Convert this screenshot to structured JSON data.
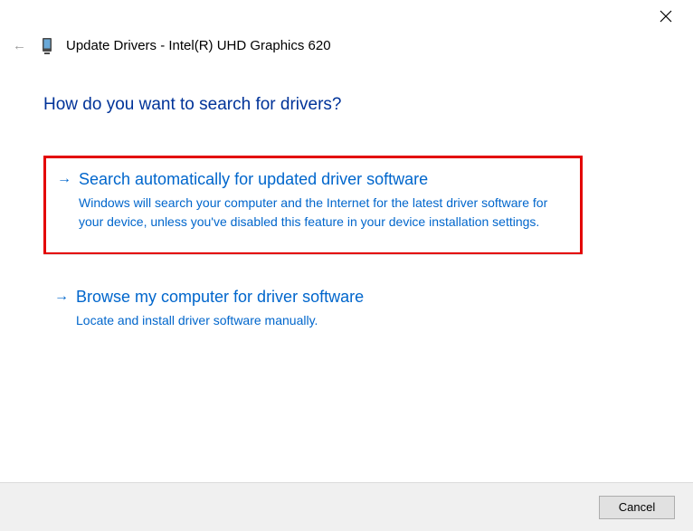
{
  "header": {
    "title": "Update Drivers - Intel(R) UHD Graphics 620"
  },
  "question": "How do you want to search for drivers?",
  "options": {
    "auto": {
      "title": "Search automatically for updated driver software",
      "description": "Windows will search your computer and the Internet for the latest driver software for your device, unless you've disabled this feature in your device installation settings."
    },
    "browse": {
      "title": "Browse my computer for driver software",
      "description": "Locate and install driver software manually."
    }
  },
  "footer": {
    "cancel": "Cancel"
  }
}
